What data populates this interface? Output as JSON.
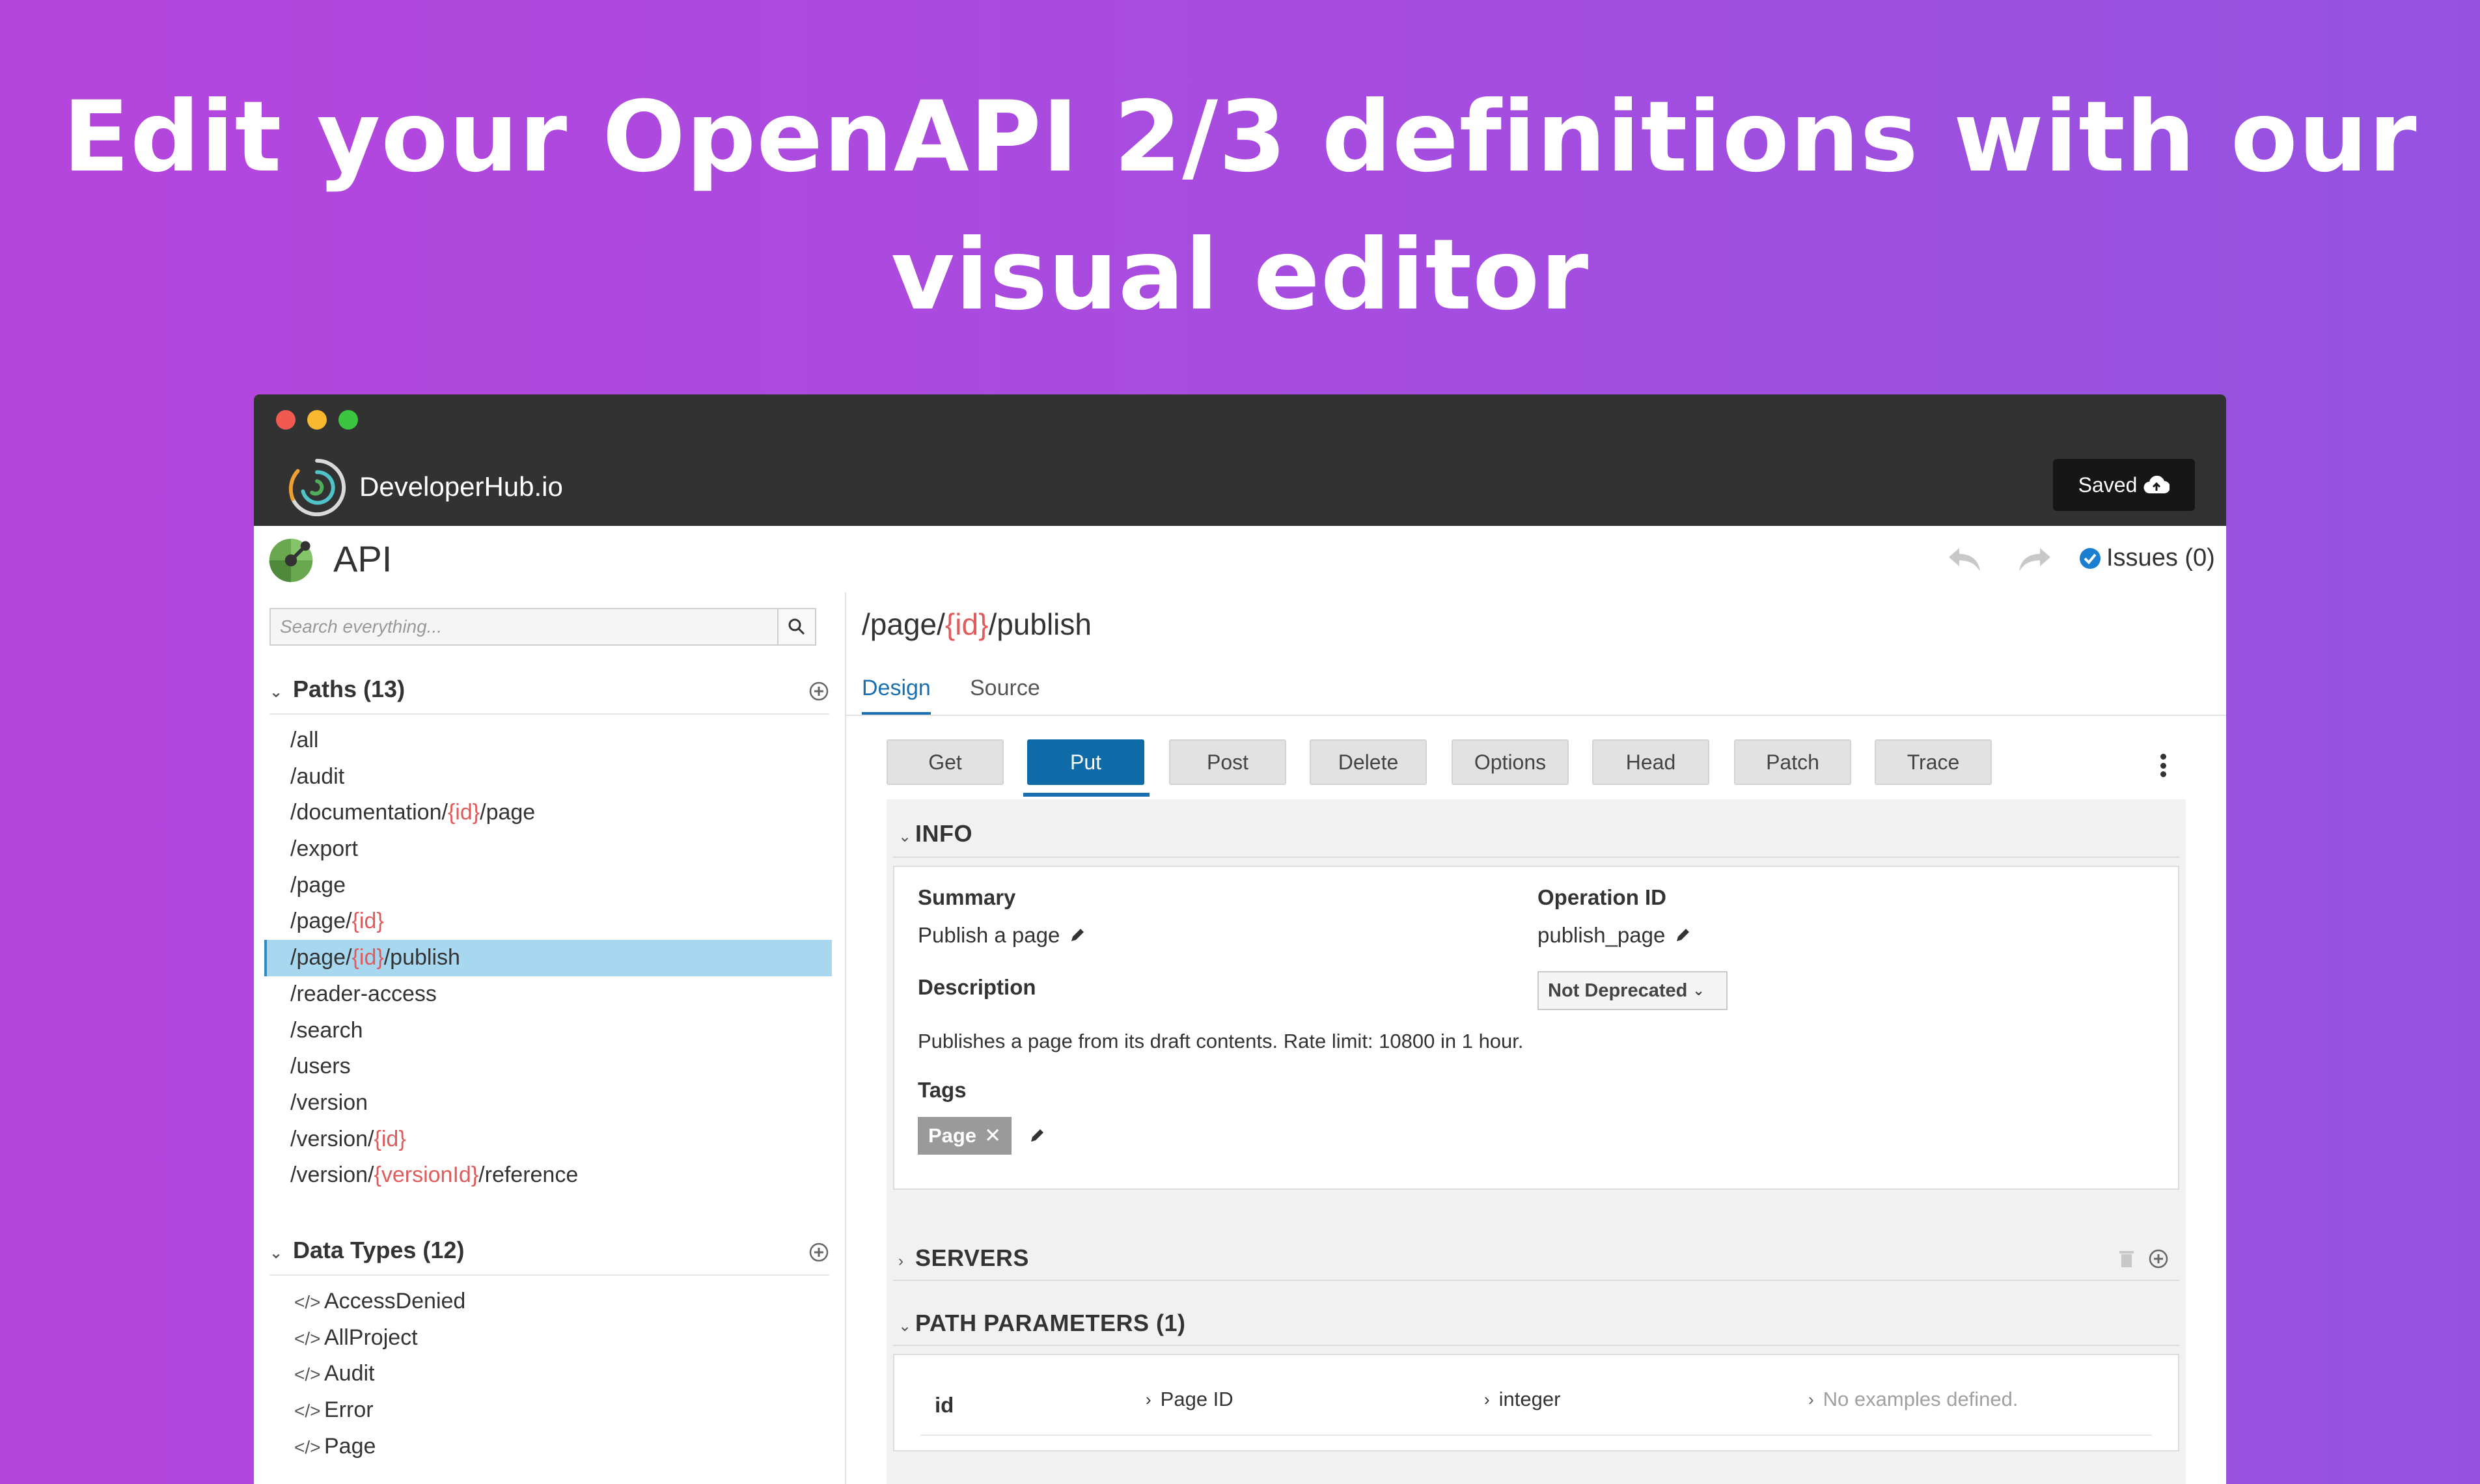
{
  "headline": {
    "line1": "Edit your OpenAPI 2/3 definitions with our",
    "line2": "visual editor"
  },
  "titlebar": {
    "brand_name": "DeveloperHub.io",
    "saved_label": "Saved",
    "traffic_lights": [
      "#f15a50",
      "#f8b830",
      "#3cc63f"
    ]
  },
  "appbar": {
    "title": "API",
    "issues_label": "Issues (0)"
  },
  "sidebar": {
    "search_placeholder": "Search everything...",
    "paths_header": "Paths (13)",
    "paths": [
      {
        "pre": "/all",
        "param": "",
        "post": ""
      },
      {
        "pre": "/audit",
        "param": "",
        "post": ""
      },
      {
        "pre": "/documentation/",
        "param": "{id}",
        "post": "/page"
      },
      {
        "pre": "/export",
        "param": "",
        "post": ""
      },
      {
        "pre": "/page",
        "param": "",
        "post": ""
      },
      {
        "pre": "/page/",
        "param": "{id}",
        "post": ""
      },
      {
        "pre": "/page/",
        "param": "{id}",
        "post": "/publish"
      },
      {
        "pre": "/reader-access",
        "param": "",
        "post": ""
      },
      {
        "pre": "/search",
        "param": "",
        "post": ""
      },
      {
        "pre": "/users",
        "param": "",
        "post": ""
      },
      {
        "pre": "/version",
        "param": "",
        "post": ""
      },
      {
        "pre": "/version/",
        "param": "{id}",
        "post": ""
      },
      {
        "pre": "/version/",
        "param": "{versionId}",
        "post": "/reference"
      }
    ],
    "types_header": "Data Types (12)",
    "types": [
      "AccessDenied",
      "AllProject",
      "Audit",
      "Error",
      "Page"
    ]
  },
  "main": {
    "title_pre": "/page/",
    "title_param": "{id}",
    "title_post": "/publish",
    "tabs": [
      "Design",
      "Source"
    ],
    "methods": [
      "Get",
      "Put",
      "Post",
      "Delete",
      "Options",
      "Head",
      "Patch",
      "Trace"
    ],
    "info": {
      "header": "INFO",
      "summary_label": "Summary",
      "summary_value": "Publish a page",
      "operation_id_label": "Operation ID",
      "operation_id_value": "publish_page",
      "description_label": "Description",
      "deprecated_select": "Not Deprecated",
      "description_text": "Publishes a page from its draft contents. Rate limit: 10800 in 1 hour.",
      "tags_label": "Tags",
      "tag": "Page"
    },
    "servers_header": "SERVERS",
    "path_params": {
      "header": "PATH PARAMETERS (1)",
      "name": "id",
      "description": "Page ID",
      "type": "integer",
      "examples": "No examples defined."
    }
  },
  "colors": {
    "accent": "#1a6fb0",
    "param": "#e05c5c",
    "selected_row": "#a7d8f0",
    "titlebar": "#323232"
  }
}
